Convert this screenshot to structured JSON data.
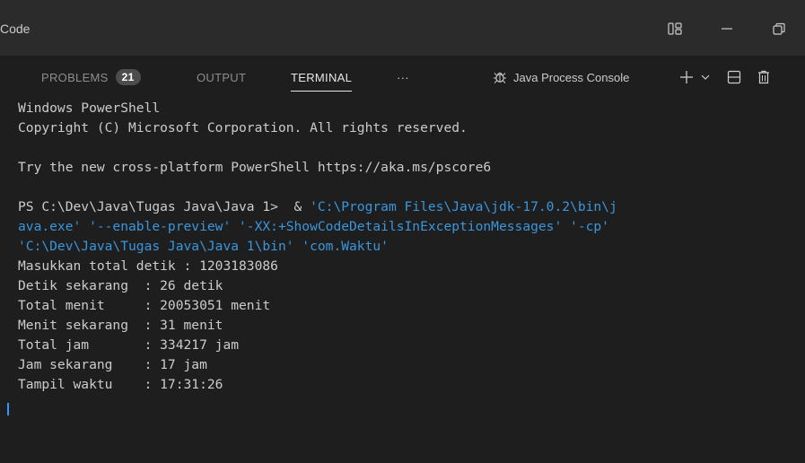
{
  "window": {
    "title": "Code",
    "controls": [
      "layout-icon",
      "minimize-icon",
      "restore-icon"
    ]
  },
  "panel": {
    "tabs": [
      {
        "label": "PROBLEMS",
        "badge": "21",
        "active": false
      },
      {
        "label": "OUTPUT",
        "active": false
      },
      {
        "label": "TERMINAL",
        "active": true
      }
    ],
    "more_label": "···",
    "console_name": "Java Process Console",
    "toolbar_icons": [
      "add-terminal-icon",
      "chevron-down-icon",
      "split-terminal-icon",
      "trash-icon"
    ]
  },
  "terminal": {
    "header_lines": [
      "Windows PowerShell",
      "Copyright (C) Microsoft Corporation. All rights reserved.",
      "",
      "Try the new cross-platform PowerShell https://aka.ms/pscore6",
      ""
    ],
    "prompt": "PS C:\\Dev\\Java\\Tugas Java\\Java 1>  & ",
    "command_first": "'C:\\Program Files\\Java\\jdk-17.0.2\\bin\\j",
    "command_cont": [
      "ava.exe' '--enable-preview' '-XX:+ShowCodeDetailsInExceptionMessages' '-cp'",
      "'C:\\Dev\\Java\\Tugas Java\\Java 1\\bin' 'com.Waktu'"
    ],
    "output_lines": [
      "Masukkan total detik : 1203183086",
      "Detik sekarang  : 26 detik",
      "Total menit     : 20053051 menit",
      "Menit sekarang  : 31 menit",
      "Total jam       : 334217 jam",
      "Jam sekarang    : 17 jam",
      "Tampil waktu    : 17:31:26"
    ]
  },
  "colors": {
    "background": "#1e1e1e",
    "titlebar": "#2b2b2b",
    "text": "#cccccc",
    "command": "#3a96dd",
    "badge": "#4d4d4d"
  }
}
